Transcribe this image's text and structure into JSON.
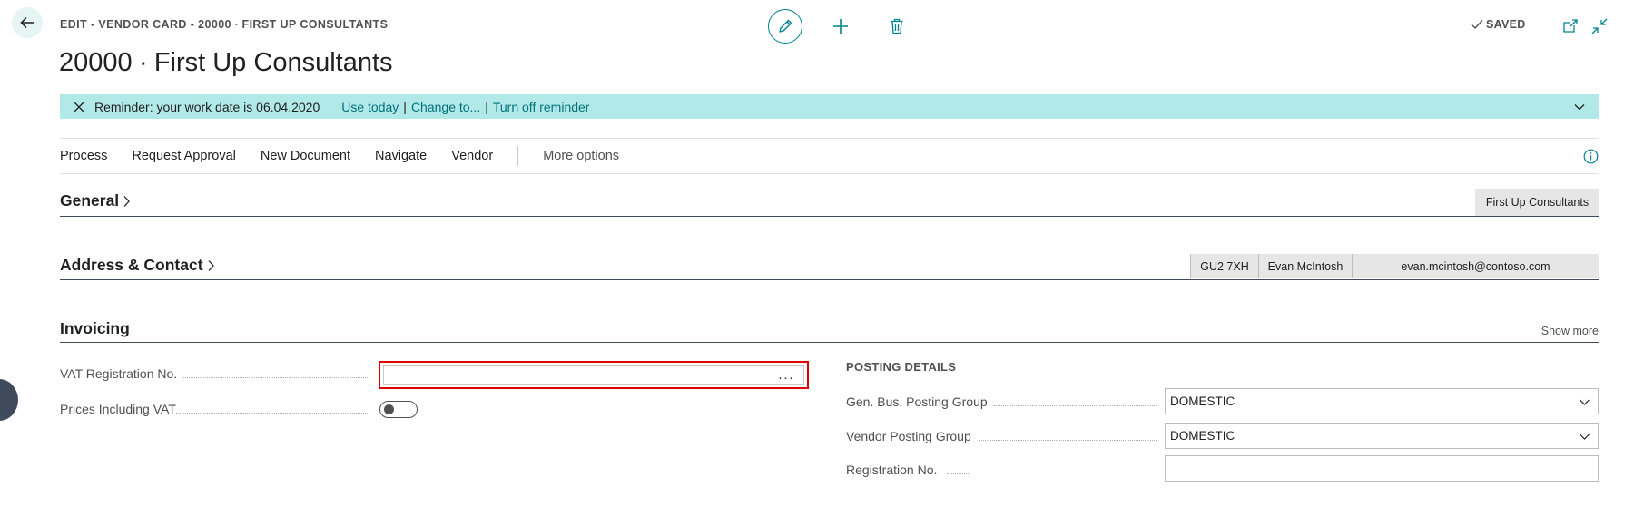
{
  "header": {
    "breadcrumb": "EDIT - VENDOR CARD - 20000 ∙ FIRST UP CONSULTANTS",
    "title": "20000 ∙ First Up Consultants",
    "saved_label": "SAVED"
  },
  "reminder": {
    "text": "Reminder: your work date is 06.04.2020",
    "links": [
      "Use today",
      "Change to...",
      "Turn off reminder"
    ],
    "separator": "|"
  },
  "actions": {
    "items": [
      "Process",
      "Request Approval",
      "New Document",
      "Navigate",
      "Vendor"
    ],
    "more": "More options"
  },
  "sections": {
    "general": {
      "title": "General",
      "brick": "First Up Consultants"
    },
    "address": {
      "title": "Address & Contact",
      "bricks": [
        "GU2 7XH",
        "Evan McIntosh",
        "evan.mcintosh@contoso.com"
      ]
    },
    "invoicing": {
      "title": "Invoicing",
      "show_more": "Show more",
      "fields": {
        "vat_label": "VAT Registration No.",
        "vat_value": "",
        "vat_ellipsis": "···",
        "prices_label": "Prices Including VAT",
        "prices_value": false
      },
      "posting": {
        "header": "POSTING DETAILS",
        "gen_bus_label": "Gen. Bus. Posting Group",
        "gen_bus_value": "DOMESTIC",
        "vendor_label": "Vendor Posting Group",
        "vendor_value": "DOMESTIC",
        "reg_label": "Registration No.",
        "reg_value": ""
      }
    }
  },
  "colors": {
    "accent": "#00838f",
    "reminder_bg": "#b1e8e8",
    "link": "#00727c",
    "highlight": "#e00000",
    "section_rule": "#3f4a5a"
  },
  "icons": {
    "back": "arrow-left-icon",
    "edit": "pencil-icon",
    "add": "plus-icon",
    "delete": "trash-icon",
    "saved": "checkmark-icon",
    "popout": "open-in-new-window-icon",
    "collapse": "collapse-icon",
    "close": "close-icon",
    "chevron": "chevron-down-icon",
    "info": "info-icon"
  }
}
